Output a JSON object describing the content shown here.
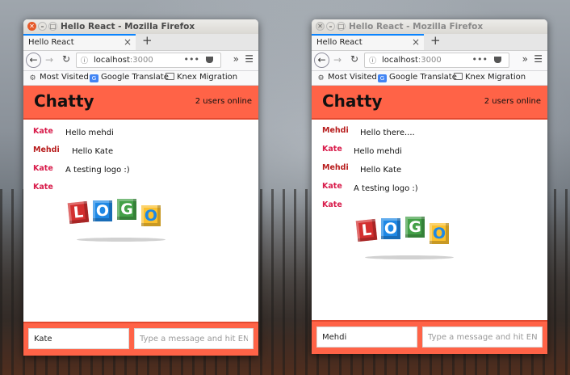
{
  "windows": [
    {
      "title": "Hello React - Mozilla Firefox",
      "tab_label": "Hello React",
      "url_host": "localhost",
      "url_port": ":3000",
      "bookmarks": [
        "Most Visited",
        "Google Translate",
        "Knex Migration"
      ],
      "app_title": "Chatty",
      "users_online": "2 users online",
      "messages": [
        {
          "user": "Kate",
          "text": "Hello mehdi"
        },
        {
          "user": "Mehdi",
          "text": "Hello Kate"
        },
        {
          "user": "Kate",
          "text": "A testing logo :)"
        },
        {
          "user": "Kate",
          "text": ""
        }
      ],
      "logo_letters": [
        "L",
        "O",
        "G",
        "O"
      ],
      "username_value": "Kate",
      "message_placeholder": "Type a message and hit ENTER"
    },
    {
      "title": "Hello React - Mozilla Firefox",
      "tab_label": "Hello React",
      "url_host": "localhost",
      "url_port": ":3000",
      "bookmarks": [
        "Most Visited",
        "Google Translate",
        "Knex Migration"
      ],
      "app_title": "Chatty",
      "users_online": "2 users online",
      "messages": [
        {
          "user": "Mehdi",
          "text": "Hello there...."
        },
        {
          "user": "Kate",
          "text": "Hello mehdi"
        },
        {
          "user": "Mehdi",
          "text": "Hello Kate"
        },
        {
          "user": "Kate",
          "text": "A testing logo :)"
        },
        {
          "user": "Kate",
          "text": ""
        }
      ],
      "logo_letters": [
        "L",
        "O",
        "G",
        "O"
      ],
      "username_value": "Mehdi",
      "message_placeholder": "Type a message and hit ENTER"
    }
  ],
  "colors": {
    "accent": "#ff6347",
    "username_red": "#c8102e"
  }
}
